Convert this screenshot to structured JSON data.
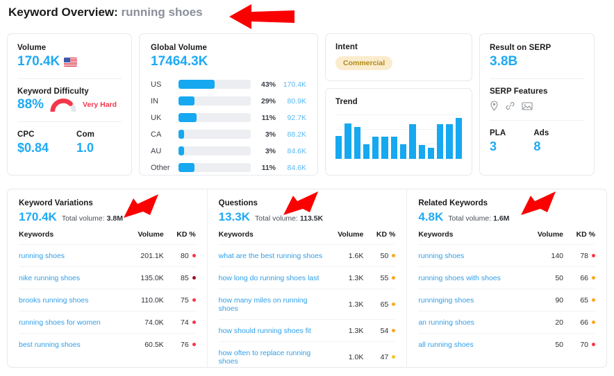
{
  "header": {
    "prefix": "Keyword Overview:",
    "keyword": "running shoes"
  },
  "colors": {
    "accent_blue": "#1eaaf4",
    "bar_blue": "#16a8f0",
    "link_blue": "#2f9fe8",
    "kd_red": "#f5364a",
    "kd_dark_red": "#9e1230",
    "kd_orange": "#f7a823",
    "intent_bg": "#faeccd",
    "intent_text": "#b08a14",
    "arrow_red": "#fa0000"
  },
  "volume_card": {
    "volume_label": "Volume",
    "volume_value": "170.4K",
    "flag_icon": "us-flag-icon",
    "kd_label": "Keyword Difficulty",
    "kd_value": "88%",
    "kd_rating": "Very Hard",
    "cpc_label": "CPC",
    "cpc_value": "$0.84",
    "com_label": "Com",
    "com_value": "1.0"
  },
  "global_volume": {
    "label": "Global Volume",
    "value": "17464.3K",
    "rows": [
      {
        "country": "US",
        "pct": "43%",
        "volume": "170.4K",
        "fill": 50
      },
      {
        "country": "IN",
        "pct": "29%",
        "volume": "80.9K",
        "fill": 22
      },
      {
        "country": "UK",
        "pct": "11%",
        "volume": "92.7K",
        "fill": 25
      },
      {
        "country": "CA",
        "pct": "3%",
        "volume": "88.2K",
        "fill": 8
      },
      {
        "country": "AU",
        "pct": "3%",
        "volume": "84.6K",
        "fill": 8
      },
      {
        "country": "Other",
        "pct": "11%",
        "volume": "84.6K",
        "fill": 22
      }
    ]
  },
  "intent": {
    "label": "Intent",
    "value": "Commercial"
  },
  "trend": {
    "label": "Trend",
    "chart_data": {
      "type": "bar",
      "title": "Trend",
      "xlabel": "",
      "ylabel": "",
      "categories": [
        "1",
        "2",
        "3",
        "4",
        "5",
        "6",
        "7",
        "8",
        "9",
        "10",
        "11",
        "12",
        "13"
      ],
      "values": [
        52,
        80,
        72,
        33,
        50,
        50,
        50,
        33,
        78,
        32,
        25,
        78,
        78,
        92
      ],
      "ylim": [
        0,
        100
      ],
      "grid": true,
      "legend": "none"
    },
    "bars": [
      52,
      80,
      72,
      33,
      50,
      50,
      50,
      33,
      78,
      32,
      25,
      78,
      78,
      92
    ]
  },
  "serp": {
    "result_label": "Result on SERP",
    "result_value": "3.8B",
    "features_label": "SERP Features",
    "feature_icons": [
      "map-pin-icon",
      "link-icon",
      "image-icon"
    ],
    "pla_label": "PLA",
    "pla_value": "3",
    "ads_label": "Ads",
    "ads_value": "8"
  },
  "tables": {
    "columns": [
      "Keywords",
      "Volume",
      "KD %"
    ],
    "keyword_variations": {
      "title": "Keyword Variations",
      "count": "170.4K",
      "total_label": "Total volume:",
      "total_value": "3.8M",
      "rows": [
        {
          "keyword": "running shoes",
          "volume": "201.1K",
          "kd": "80",
          "dot": "#f5364a"
        },
        {
          "keyword": "nike running shoes",
          "volume": "135.0K",
          "kd": "85",
          "dot": "#9e1230"
        },
        {
          "keyword": "brooks running shoes",
          "volume": "110.0K",
          "kd": "75",
          "dot": "#f5364a"
        },
        {
          "keyword": "running shoes for women",
          "volume": "74.0K",
          "kd": "74",
          "dot": "#f5364a"
        },
        {
          "keyword": "best running shoes",
          "volume": "60.5K",
          "kd": "76",
          "dot": "#f5364a"
        }
      ]
    },
    "questions": {
      "title": "Questions",
      "count": "13.3K",
      "total_label": "Total volume:",
      "total_value": "113.5K",
      "rows": [
        {
          "keyword": "what are the best running shoes",
          "volume": "1.6K",
          "kd": "50",
          "dot": "#f7a823"
        },
        {
          "keyword": "how long do running shoes last",
          "volume": "1.3K",
          "kd": "55",
          "dot": "#f7a823"
        },
        {
          "keyword": "how many miles on running shoes",
          "volume": "1.3K",
          "kd": "65",
          "dot": "#f7a823"
        },
        {
          "keyword": "how should running shoes fit",
          "volume": "1.3K",
          "kd": "54",
          "dot": "#f7a823"
        },
        {
          "keyword": "how often to replace running shoes",
          "volume": "1.0K",
          "kd": "47",
          "dot": "#f7c423"
        }
      ]
    },
    "related_keywords": {
      "title": "Related Keywords",
      "count": "4.8K",
      "total_label": "Total volume:",
      "total_value": "1.6M",
      "rows": [
        {
          "keyword": "running shoes",
          "volume": "140",
          "kd": "78",
          "dot": "#f5364a"
        },
        {
          "keyword": "running shoes with shoes",
          "volume": "50",
          "kd": "66",
          "dot": "#f7a823"
        },
        {
          "keyword": "runninging shoes",
          "volume": "90",
          "kd": "65",
          "dot": "#f7a823"
        },
        {
          "keyword": "an running shoes",
          "volume": "20",
          "kd": "66",
          "dot": "#f7a823"
        },
        {
          "keyword": "all running shoes",
          "volume": "50",
          "kd": "70",
          "dot": "#f5364a"
        }
      ]
    }
  }
}
